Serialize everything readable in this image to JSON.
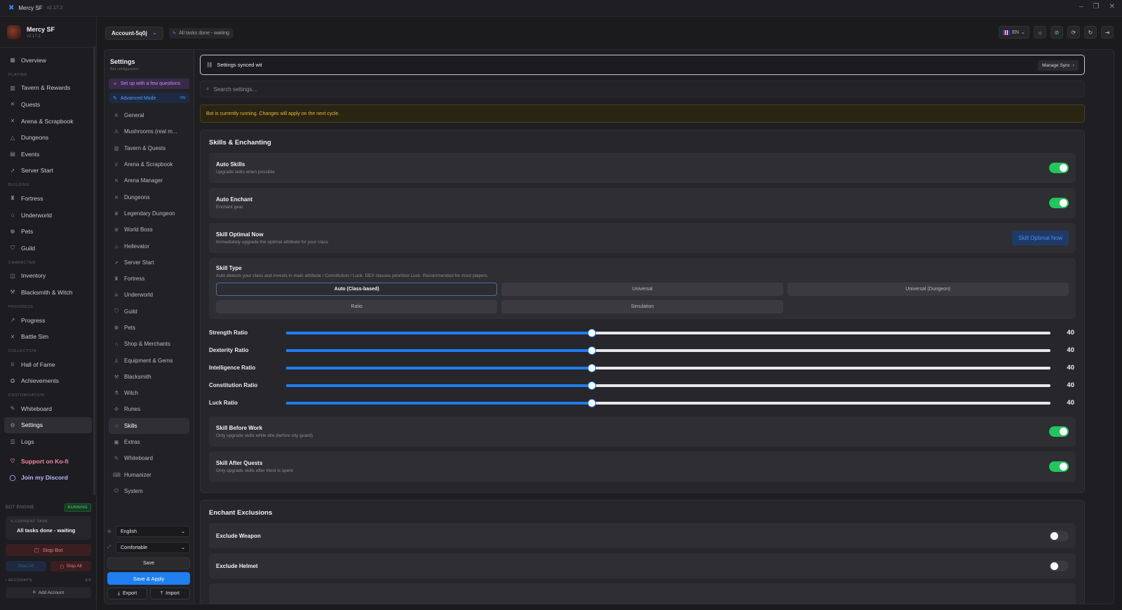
{
  "window": {
    "app_name": "Mercy SF",
    "version": "v2.17.2"
  },
  "profile": {
    "name": "Mercy SF",
    "version": "v2.17.2"
  },
  "sidebar": {
    "overview": "Overview",
    "sections": {
      "playing": "PLAYING",
      "building": "BUILDING",
      "character": "CHARACTER",
      "progress": "PROGRESS",
      "collection": "COLLECTION",
      "customization": "CUSTOMIZATION"
    },
    "playing": [
      "Tavern & Rewards",
      "Quests",
      "Arena & Scrapbook",
      "Dungeons",
      "Events",
      "Server Start"
    ],
    "building": [
      "Fortress",
      "Underworld",
      "Pets",
      "Guild"
    ],
    "character": [
      "Inventory",
      "Blacksmith & Witch"
    ],
    "progress": [
      "Progress",
      "Battle Sim"
    ],
    "collection": [
      "Hall of Fame",
      "Achievements"
    ],
    "customization": [
      "Whiteboard",
      "Settings",
      "Logs"
    ],
    "kofi": "Support on Ko-fi",
    "discord": "Join my Discord"
  },
  "engine": {
    "label": "BOT ENGINE",
    "status": "RUNNING",
    "current_task_label": "CURRENT TASK",
    "current_task": "All tasks done - waiting",
    "stop_bot": "Stop Bot",
    "start_all": "Start All",
    "stop_all": "Stop All",
    "accounts_label": "ACCOUNTS",
    "accounts_count": "4/4",
    "add_account": "Add Account"
  },
  "topbar": {
    "account": "Account-5q0j",
    "task_status": "All tasks done - waiting",
    "language": "EN"
  },
  "settings": {
    "title": "Settings",
    "subtitle": "Bot configuration",
    "setup": "Set up with a few questions",
    "advanced": "Advanced Mode",
    "advanced_state": "ON",
    "nav": [
      "General",
      "Mushrooms (real m...",
      "Tavern & Quests",
      "Arena & Scrapbook",
      "Arena Manager",
      "Dungeons",
      "Legendary Dungeon",
      "World Boss",
      "Hellevator",
      "Server Start",
      "Fortress",
      "Underworld",
      "Guild",
      "Pets",
      "Shop & Merchants",
      "Equipment & Gems",
      "Blacksmith",
      "Witch",
      "Runes",
      "Skills",
      "Extras",
      "Whiteboard",
      "Humanizer",
      "System"
    ],
    "language_select": "English",
    "density_select": "Comfortable",
    "save": "Save",
    "save_apply": "Save & Apply",
    "export": "Export",
    "import": "Import"
  },
  "main": {
    "sync_text": "Settings synced wit",
    "manage_sync": "Manage Sync",
    "search_placeholder": "Search settings...",
    "warning": "Bot is currently running. Changes will apply on the next cycle.",
    "skills_section": {
      "title": "Skills & Enchanting",
      "auto_skills": {
        "title": "Auto Skills",
        "desc": "Upgrade skills when possible",
        "on": true
      },
      "auto_enchant": {
        "title": "Auto Enchant",
        "desc": "Enchant gear",
        "on": true
      },
      "skill_optimal": {
        "title": "Skill Optimal Now",
        "desc": "Immediately upgrade the optimal attribute for your class",
        "button": "Skill Optimal Now"
      },
      "skill_type": {
        "title": "Skill Type",
        "desc": "Auto detects your class and invests in main attribute / Constitution / Luck. DEX classes prioritize Luck. Recommended for most players.",
        "options": [
          "Auto (Class-based)",
          "Universal",
          "Universal (Dungeon)",
          "Ratio",
          "Simulation"
        ],
        "selected": "Auto (Class-based)"
      },
      "ratios": [
        {
          "label": "Strength Ratio",
          "value": 40,
          "fraction": 0.4
        },
        {
          "label": "Dexterity Ratio",
          "value": 40,
          "fraction": 0.4
        },
        {
          "label": "Intelligence Ratio",
          "value": 40,
          "fraction": 0.4
        },
        {
          "label": "Constitution Ratio",
          "value": 40,
          "fraction": 0.4
        },
        {
          "label": "Luck Ratio",
          "value": 40,
          "fraction": 0.4
        }
      ],
      "skill_before_work": {
        "title": "Skill Before Work",
        "desc": "Only upgrade skills while idle (before city guard)",
        "on": true
      },
      "skill_after_quests": {
        "title": "Skill After Quests",
        "desc": "Only upgrade skills after thirst is spent",
        "on": true
      }
    },
    "enchant_section": {
      "title": "Enchant Exclusions",
      "exclude_weapon": {
        "title": "Exclude Weapon",
        "on": false
      },
      "exclude_helmet": {
        "title": "Exclude Helmet",
        "on": false
      }
    }
  },
  "colors": {
    "accent": "#1f7ef0",
    "toggle_on": "#22c55e",
    "warning": "#e8b63c",
    "running": "#4ade80"
  }
}
